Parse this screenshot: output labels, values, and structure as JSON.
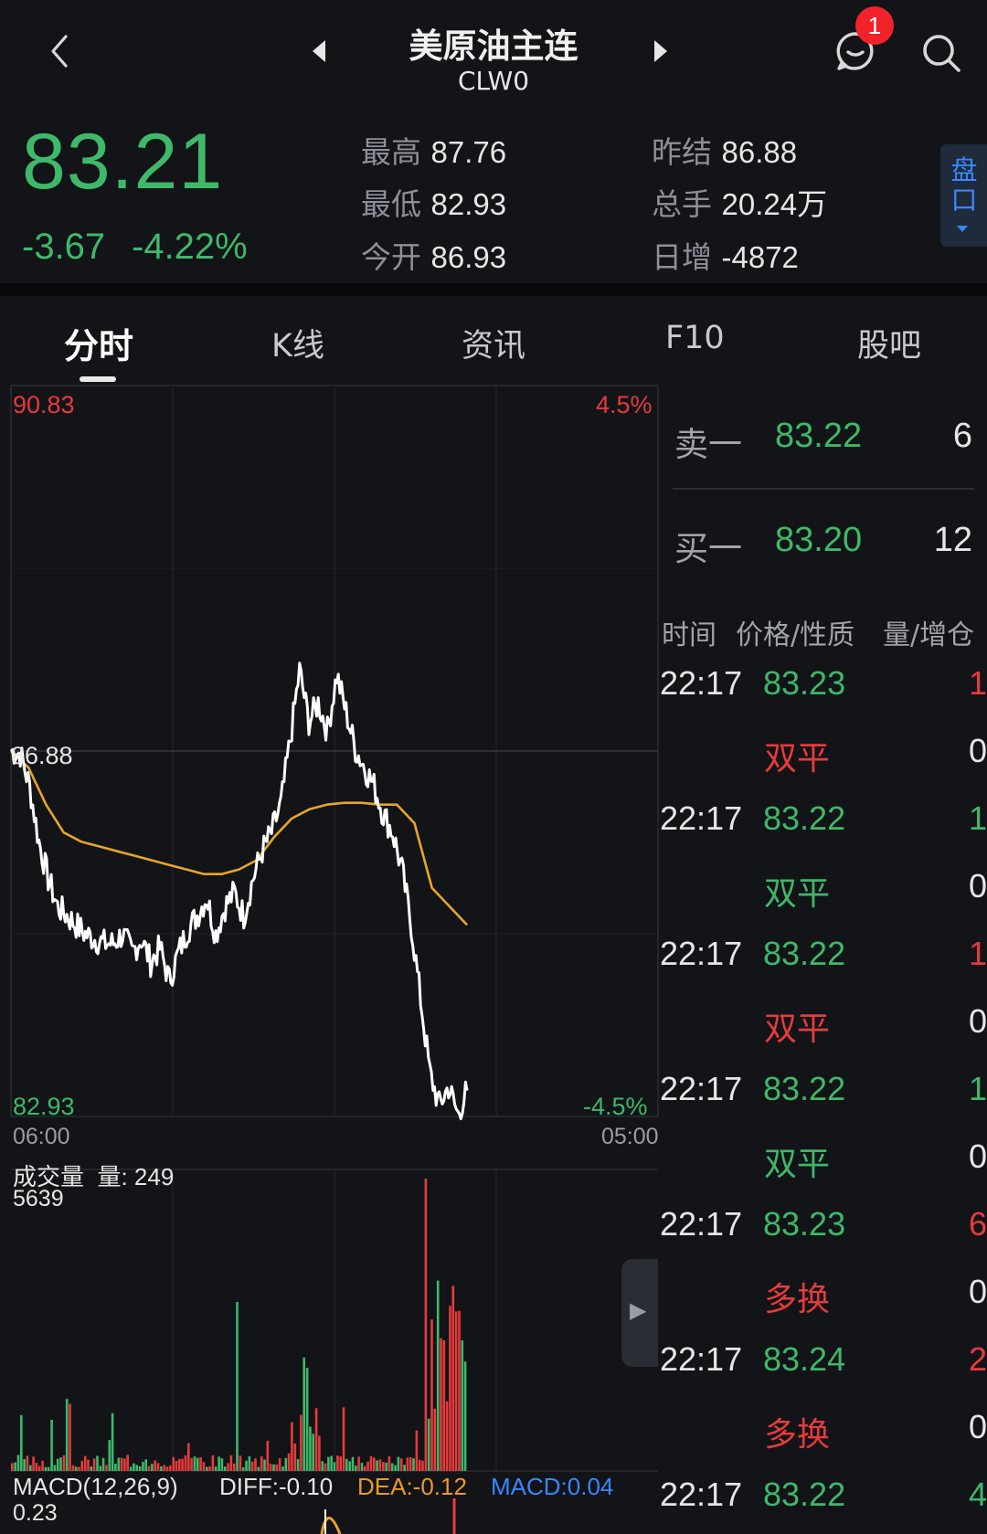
{
  "header": {
    "title": "美原油主连",
    "code": "CLW0",
    "notification_count": "1"
  },
  "quote": {
    "price": "83.21",
    "change": "-3.67",
    "change_pct": "-4.22%",
    "high_label": "最高",
    "high": "87.76",
    "low_label": "最低",
    "low": "82.93",
    "open_label": "今开",
    "open": "86.93",
    "prev_settle_label": "昨结",
    "prev_settle": "86.88",
    "volume_label": "总手",
    "volume": "20.24万",
    "oi_change_label": "日增",
    "oi_change": "-4872",
    "pankou_label": "盘口"
  },
  "tabs": [
    "分时",
    "K线",
    "资讯",
    "F10",
    "股吧"
  ],
  "chart": {
    "price_max": "90.83",
    "price_min": "82.93",
    "pct_max": "4.5%",
    "pct_min": "-4.5%",
    "base_label": "86.88",
    "time_start": "06:00",
    "time_end": "05:00",
    "volume_title": "成交量",
    "volume_value_label": "量: 249",
    "volume_max": "5639",
    "macd_label": "MACD(12,26,9)",
    "diff_label": "DIFF:-0.10",
    "dea_label": "DEA:-0.12",
    "macd_value_label": "MACD:0.04",
    "macd_max": "0.23",
    "colors": {
      "line": "#ffffff",
      "avg": "#e8a528",
      "up": "#e63b3b",
      "down": "#3fb86a"
    }
  },
  "chart_data": {
    "type": "line",
    "x": [
      "06:00",
      "05:00"
    ],
    "ylim": [
      82.93,
      90.83
    ],
    "ylim_pct": [
      "-4.5%",
      "4.5%"
    ],
    "reference_price": 86.88,
    "series": [
      {
        "values": [
          86.88,
          86.85,
          86.5,
          85.9,
          85.5,
          85.2,
          85.1,
          85.0,
          84.9,
          84.85,
          84.8,
          84.8,
          84.9,
          84.7,
          84.85,
          84.6,
          84.75,
          84.4,
          84.7,
          84.95,
          85.1,
          85.3,
          84.9,
          85.2,
          85.35,
          85.1,
          85.5,
          85.8,
          86.0,
          86.3,
          87.0,
          87.75,
          87.2,
          87.4,
          87.1,
          87.7,
          87.3,
          86.9,
          86.7,
          86.5,
          86.2,
          86.0,
          85.6,
          85.0,
          84.2,
          83.4,
          83.05,
          83.25,
          82.95,
          83.21
        ]
      },
      {
        "values": [
          86.88,
          86.7,
          86.3,
          86.0,
          85.9,
          85.85,
          85.8,
          85.75,
          85.7,
          85.65,
          85.6,
          85.55,
          85.55,
          85.6,
          85.7,
          85.95,
          86.15,
          86.25,
          86.3,
          86.32,
          86.32,
          86.3,
          86.3,
          86.1,
          85.4,
          85.2,
          85.0
        ]
      }
    ],
    "volume_max": 5639,
    "volume_current": 249,
    "macd": {
      "diff": -0.1,
      "dea": -0.12,
      "macd": 0.04,
      "max": 0.23
    }
  },
  "orderbook": {
    "ask": {
      "label": "卖一",
      "price": "83.22",
      "qty": "6"
    },
    "bid": {
      "label": "买一",
      "price": "83.20",
      "qty": "12"
    }
  },
  "trades_header": {
    "time": "时间",
    "price": "价格/性质",
    "qty": "量/增仓"
  },
  "trades": [
    {
      "time": "22:17",
      "price": "83.23",
      "qty": "1",
      "qty_color": "red",
      "nature": "双平",
      "nature_color": "red",
      "oi": "0"
    },
    {
      "time": "22:17",
      "price": "83.22",
      "qty": "1",
      "qty_color": "green",
      "nature": "双平",
      "nature_color": "green",
      "oi": "0"
    },
    {
      "time": "22:17",
      "price": "83.22",
      "qty": "1",
      "qty_color": "red",
      "nature": "双平",
      "nature_color": "red",
      "oi": "0"
    },
    {
      "time": "22:17",
      "price": "83.22",
      "qty": "1",
      "qty_color": "green",
      "nature": "双平",
      "nature_color": "green",
      "oi": "0"
    },
    {
      "time": "22:17",
      "price": "83.23",
      "qty": "6",
      "qty_color": "red",
      "nature": "多换",
      "nature_color": "red",
      "oi": "0"
    },
    {
      "time": "22:17",
      "price": "83.24",
      "qty": "2",
      "qty_color": "red",
      "nature": "多换",
      "nature_color": "red",
      "oi": "0"
    },
    {
      "time": "22:17",
      "price": "83.22",
      "qty": "4",
      "qty_color": "green"
    }
  ]
}
